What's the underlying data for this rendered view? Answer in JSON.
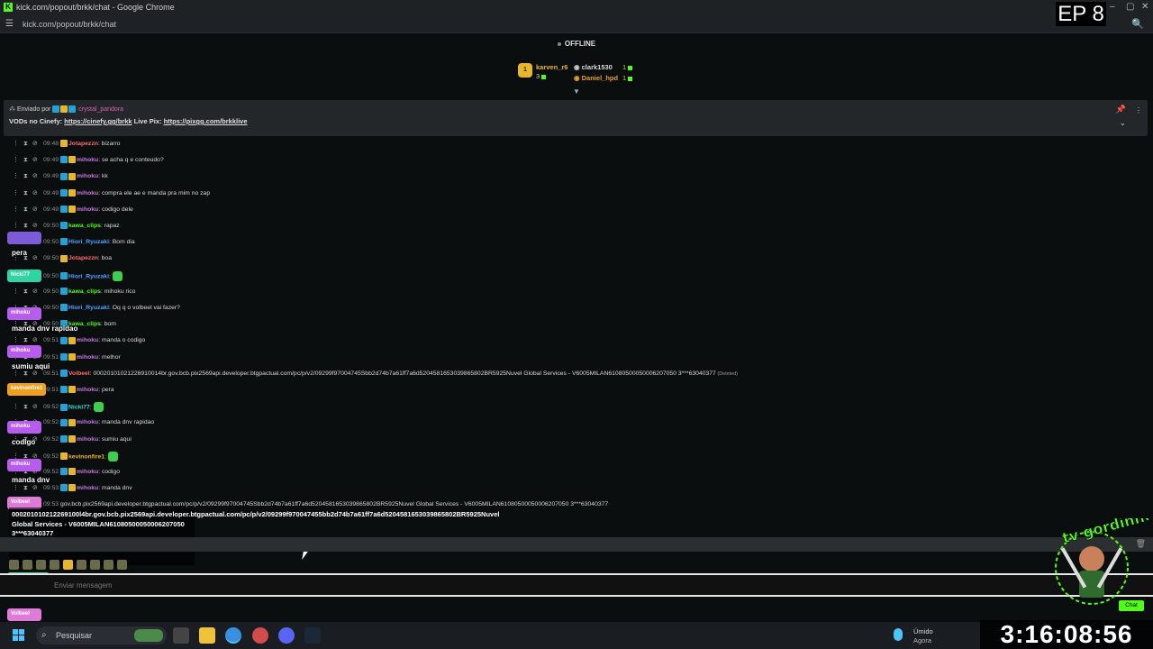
{
  "window": {
    "title": "kick.com/popout/brkk/chat - Google Chrome",
    "url": "kick.com/popout/brkk/chat"
  },
  "episode_badge": "EP 8",
  "stream_status": "OFFLINE",
  "leaderboard": {
    "rank": "1",
    "entries": [
      {
        "name": "karven_r6",
        "value": "3"
      },
      {
        "name": "clark1530",
        "value": "1"
      },
      {
        "name": "Daniel_hpd",
        "value": "1"
      }
    ]
  },
  "pinned": {
    "sent_by_label": "Enviado por",
    "sent_by_user": "crystal_pandora",
    "text_prefix": "VODs no Cinefy: ",
    "link1": "https://cinefy.gg/brkk",
    "text_middle": " Live Pix: ",
    "link2": "https://pixgg.com/brkklive"
  },
  "messages": [
    {
      "time": "09:48",
      "user": "Jotapezzn",
      "color": "#ff6b6b",
      "badges": [
        "gold"
      ],
      "text": "bizarro"
    },
    {
      "time": "09:49",
      "user": "mihoku",
      "color": "#c678dd",
      "badges": [
        "blue",
        "gold"
      ],
      "text": "se acha q e conteudo?"
    },
    {
      "time": "09:49",
      "user": "mihoku",
      "color": "#c678dd",
      "badges": [
        "blue",
        "gold"
      ],
      "text": "kk"
    },
    {
      "time": "09:49",
      "user": "mihoku",
      "color": "#c678dd",
      "badges": [
        "blue",
        "gold"
      ],
      "text": "compra ele ae e manda pra mim no zap"
    },
    {
      "time": "09:49",
      "user": "mihoku",
      "color": "#c678dd",
      "badges": [
        "blue",
        "gold"
      ],
      "text": "codigo dele"
    },
    {
      "time": "09:50",
      "user": "kawa_clips",
      "color": "#53fc18",
      "badges": [
        "blue"
      ],
      "text": "rapaz"
    },
    {
      "time": "09:50",
      "user": "Hiori_Ryuzaki",
      "color": "#4fa3ff",
      "badges": [
        "blue"
      ],
      "text": "Bom dia"
    },
    {
      "time": "09:50",
      "user": "Jotapezzn",
      "color": "#ff6b6b",
      "badges": [
        "gold"
      ],
      "text": "boa"
    },
    {
      "time": "09:50",
      "user": "Hiori_Ryuzaki",
      "color": "#4fa3ff",
      "badges": [
        "blue"
      ],
      "text": ""
    },
    {
      "time": "09:50",
      "user": "kawa_clips",
      "color": "#53fc18",
      "badges": [
        "blue"
      ],
      "text": "mihoku rico"
    },
    {
      "time": "09:50",
      "user": "Hiori_Ryuzaki",
      "color": "#4fa3ff",
      "badges": [
        "blue"
      ],
      "text": "Oq q o volbeel vai fazer?"
    },
    {
      "time": "09:50",
      "user": "kawa_clips",
      "color": "#53fc18",
      "badges": [
        "blue"
      ],
      "text": "bom"
    },
    {
      "time": "09:51",
      "user": "mihoku",
      "color": "#c678dd",
      "badges": [
        "blue",
        "gold"
      ],
      "text": "manda o codigo"
    },
    {
      "time": "09:51",
      "user": "mihoku",
      "color": "#c678dd",
      "badges": [
        "blue",
        "gold"
      ],
      "text": "melhor"
    },
    {
      "time": "09:51",
      "user": "Volbeel",
      "color": "#ff6b6b",
      "badges": [
        "blue"
      ],
      "text": "00020101021226910014br.gov.bcb.pix2569api.developer.btgpactual.com/pc/p/v2/09299f97004745Sbb2d74b7a61ff7a6d5204581653039865802BR5925Nuvel Global Services - V6005MILAN61080500050006207050 3***63040377",
      "deleted": "(Deleted)"
    },
    {
      "time": "09:51",
      "user": "mihoku",
      "color": "#c678dd",
      "badges": [
        "blue",
        "gold"
      ],
      "text": "pera"
    },
    {
      "time": "09:52",
      "user": "Nicki77",
      "color": "#2fd4d4",
      "badges": [
        "blue"
      ],
      "text": ""
    },
    {
      "time": "09:52",
      "user": "mihoku",
      "color": "#c678dd",
      "badges": [
        "blue",
        "gold"
      ],
      "text": "manda dnv rapidao"
    },
    {
      "time": "09:52",
      "user": "mihoku",
      "color": "#c678dd",
      "badges": [
        "blue",
        "gold"
      ],
      "text": "sumiu aqui"
    },
    {
      "time": "09:52",
      "user": "kevinonfire1",
      "color": "#e7b62b",
      "badges": [
        "gold"
      ],
      "text": ""
    },
    {
      "time": "09:52",
      "user": "mihoku",
      "color": "#c678dd",
      "badges": [
        "blue",
        "gold"
      ],
      "text": "codigo"
    },
    {
      "time": "09:53",
      "user": "mihoku",
      "color": "#c678dd",
      "badges": [
        "blue",
        "gold"
      ],
      "text": "manda dnv"
    },
    {
      "time": "09:53",
      "user": "",
      "color": "#cfcfcf",
      "badges": [],
      "text": "gov.bcb.pix2569api.developer.btgpactual.com/pc/p/v2/09299f97004745Sbb2d74b7a61ff7a6d5204581653039865802BR5925Nuvel Global Services - V6005MILAN61080500050006207050 3***63040377"
    }
  ],
  "overlay": [
    {
      "label": "",
      "label_color": "#7e5bd6",
      "text": "pera"
    },
    {
      "label": "Nicki77",
      "label_color": "#2fd4a0",
      "text": ""
    },
    {
      "label": "mihoku",
      "label_color": "#b85cf0",
      "text": "manda dnv rapidao"
    },
    {
      "label": "mihoku",
      "label_color": "#b85cf0",
      "text": "sumiu aqui"
    },
    {
      "label": "kevinonfire1",
      "label_color": "#f0a020",
      "text": ""
    },
    {
      "label": "mihoku",
      "label_color": "#b85cf0",
      "text": "codigo"
    },
    {
      "label": "mihoku",
      "label_color": "#b85cf0",
      "text": "manda dnv"
    },
    {
      "label": "Volbeel",
      "label_color": "#e07ad8",
      "text": ""
    },
    {
      "label": "nelson_jando",
      "label_color": "#2fd4a0",
      "text": ""
    },
    {
      "label": "Volbeel",
      "label_color": "#e07ad8",
      "text": ""
    }
  ],
  "overlay_pix_text": "000201010212269100l4br.gov.bcb.pix2569api.developer.btgpactual.com/pc/p/v2/09299f970047455bb2d74b7a61ff7a6d5204581653039865802BR5925Nuvel Global Services - V6005MILAN61080500050006207050 3***63040377",
  "chat_input": {
    "placeholder": "Enviar mensagem",
    "button": "Chat"
  },
  "taskbar": {
    "search_label": "Pesquisar",
    "weather_line1": "Úmido",
    "weather_line2": "Agora"
  },
  "clock": "3:16:08:56",
  "logo_text": "tv gordinho no pinho"
}
